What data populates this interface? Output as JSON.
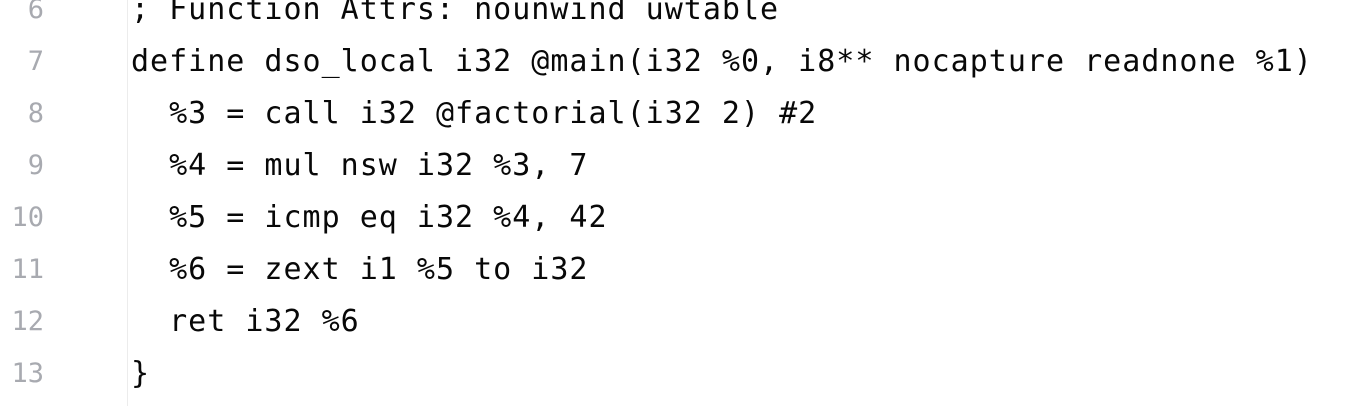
{
  "editor": {
    "lines": [
      {
        "number": "6",
        "code": "; Function Attrs: nounwind uwtable"
      },
      {
        "number": "7",
        "code": "define dso_local i32 @main(i32 %0, i8** nocapture readnone %1)"
      },
      {
        "number": "8",
        "code": "  %3 = call i32 @factorial(i32 2) #2"
      },
      {
        "number": "9",
        "code": "  %4 = mul nsw i32 %3, 7"
      },
      {
        "number": "10",
        "code": "  %5 = icmp eq i32 %4, 42"
      },
      {
        "number": "11",
        "code": "  %6 = zext i1 %5 to i32"
      },
      {
        "number": "12",
        "code": "  ret i32 %6"
      },
      {
        "number": "13",
        "code": "}"
      }
    ]
  }
}
